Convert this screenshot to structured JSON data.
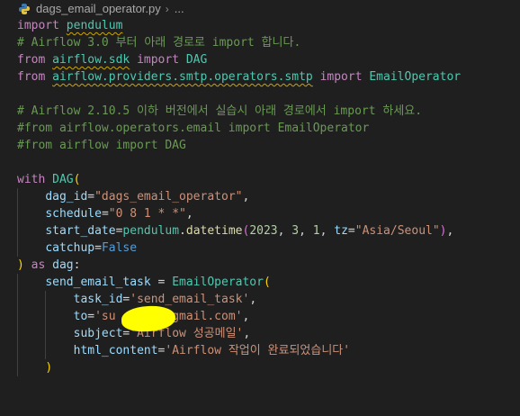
{
  "breadcrumb": {
    "file_name": "dags_email_operator.py",
    "separator": "›",
    "more": "..."
  },
  "code": {
    "l1": {
      "k": "import",
      "m": "pendulum"
    },
    "l2": "# Airflow 3.0 부터 아래 경로로 import 합니다.",
    "l3": {
      "from": "from",
      "mod": "airflow.sdk",
      "imp": "import",
      "name": "DAG"
    },
    "l4": {
      "from": "from",
      "mod": "airflow.providers.smtp.operators.smtp",
      "imp": "import",
      "name": "EmailOperator"
    },
    "l6": "# Airflow 2.10.5 이하 버전에서 실습시 아래 경로에서 import 하세요.",
    "l7": "#from airflow.operators.email import EmailOperator",
    "l8": "#from airflow import DAG",
    "l10": {
      "with": "with",
      "cls": "DAG",
      "paren": "("
    },
    "l11": {
      "param": "dag_id",
      "eq": "=",
      "val": "\"dags_email_operator\"",
      "comma": ","
    },
    "l12": {
      "param": "schedule",
      "eq": "=",
      "val": "\"0 8 1 * *\"",
      "comma": ","
    },
    "l13": {
      "param": "start_date",
      "eq": "=",
      "obj": "pendulum",
      "dot": ".",
      "fn": "datetime",
      "po": "(",
      "n1": "2023",
      "c1": ", ",
      "n2": "3",
      "c2": ", ",
      "n3": "1",
      "c3": ", ",
      "tz": "tz",
      "eq2": "=",
      "tzval": "\"Asia/Seoul\"",
      "pc": ")",
      "comma": ","
    },
    "l14": {
      "param": "catchup",
      "eq": "=",
      "val": "False"
    },
    "l15": {
      "paren": ")",
      "as": " as ",
      "var": "dag",
      "colon": ":"
    },
    "l16": {
      "var": "send_email_task",
      "eq": " = ",
      "cls": "EmailOperator",
      "paren": "("
    },
    "l17": {
      "param": "task_id",
      "eq": "=",
      "val": "'send_email_task'",
      "comma": ","
    },
    "l18": {
      "param": "to",
      "eq": "=",
      "val_a": "'su",
      "val_b": "@gmail.com'",
      "comma": ","
    },
    "l19": {
      "param": "subject",
      "eq": "=",
      "val": "'Airflow 성공메일'",
      "comma": ","
    },
    "l20": {
      "param": "html_content",
      "eq": "=",
      "val": "'Airflow 작업이 완료되었습니다'"
    },
    "l21": {
      "paren": ")"
    }
  },
  "colors": {
    "background": "#1f1f1f",
    "keyword_blue": "#569cd6",
    "keyword_purple": "#c586c0",
    "class": "#4ec9b0",
    "function": "#dcdcaa",
    "variable": "#9cdcfe",
    "string": "#ce9178",
    "number": "#b5cea8",
    "comment": "#6a9955",
    "redaction": "#ffff00"
  }
}
